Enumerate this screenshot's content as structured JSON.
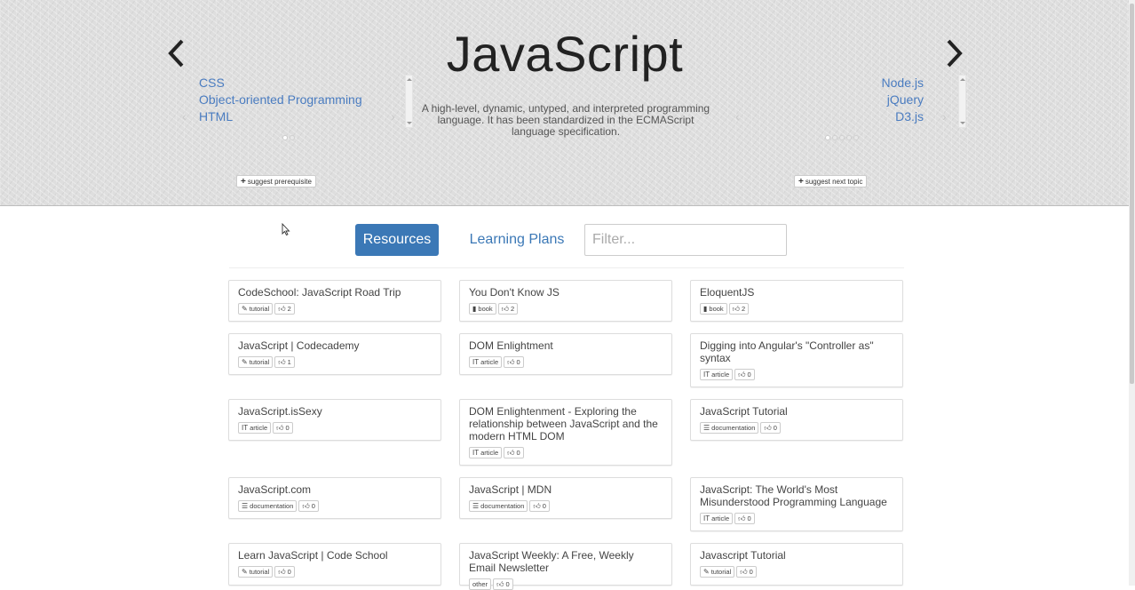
{
  "hero": {
    "title": "JavaScript",
    "description": "A high-level, dynamic, untyped, and interpreted programming language. It has been standardized in the ECMAScript language specification.",
    "prerequisites": [
      "CSS",
      "Object-oriented Programming",
      "HTML"
    ],
    "next_topics": [
      "Node.js",
      "jQuery",
      "D3.js"
    ],
    "suggest_prerequisite": "suggest prerequisite",
    "suggest_next": "suggest next topic"
  },
  "tabs": {
    "resources": "Resources",
    "learning_plans": "Learning Plans"
  },
  "filter": {
    "placeholder": "Filter...",
    "value": ""
  },
  "resources": [
    {
      "title": "CodeSchool: JavaScript Road Trip",
      "type": "tutorial",
      "type_icon": "pencil-icon",
      "votes": "2"
    },
    {
      "title": "You Don't Know JS",
      "type": "book",
      "type_icon": "book-icon",
      "votes": "2"
    },
    {
      "title": "EloquentJS",
      "type": "book",
      "type_icon": "book-icon",
      "votes": "2"
    },
    {
      "title": "JavaScript | Codecademy",
      "type": "tutorial",
      "type_icon": "pencil-icon",
      "votes": "1"
    },
    {
      "title": "DOM Enlightment",
      "type": "article",
      "type_icon": "text-icon",
      "votes": "0"
    },
    {
      "title": "Digging into Angular's \"Controller as\" syntax",
      "type": "article",
      "type_icon": "text-icon",
      "votes": "0"
    },
    {
      "title": "JavaScript.isSexy",
      "type": "article",
      "type_icon": "text-icon",
      "votes": "0"
    },
    {
      "title": "DOM Enlightenment - Exploring the relationship between JavaScript and the modern HTML DOM",
      "type": "article",
      "type_icon": "text-icon",
      "votes": "0"
    },
    {
      "title": "JavaScript Tutorial",
      "type": "documentation",
      "type_icon": "list-icon",
      "votes": "0"
    },
    {
      "title": "JavaScript.com",
      "type": "documentation",
      "type_icon": "list-icon",
      "votes": "0"
    },
    {
      "title": "JavaScript | MDN",
      "type": "documentation",
      "type_icon": "list-icon",
      "votes": "0"
    },
    {
      "title": "JavaScript: The World's Most Misunderstood Programming Language",
      "type": "article",
      "type_icon": "text-icon",
      "votes": "0"
    },
    {
      "title": "Learn JavaScript | Code School",
      "type": "tutorial",
      "type_icon": "pencil-icon",
      "votes": "0"
    },
    {
      "title": "JavaScript Weekly: A Free, Weekly Email Newsletter",
      "type": "other",
      "type_icon": "",
      "votes": "0"
    },
    {
      "title": "Javascript Tutorial",
      "type": "tutorial",
      "type_icon": "pencil-icon",
      "votes": "0"
    }
  ],
  "colors": {
    "accent": "#3b78b6",
    "link": "#4a7cc0",
    "hero_bg": "#dedede"
  }
}
